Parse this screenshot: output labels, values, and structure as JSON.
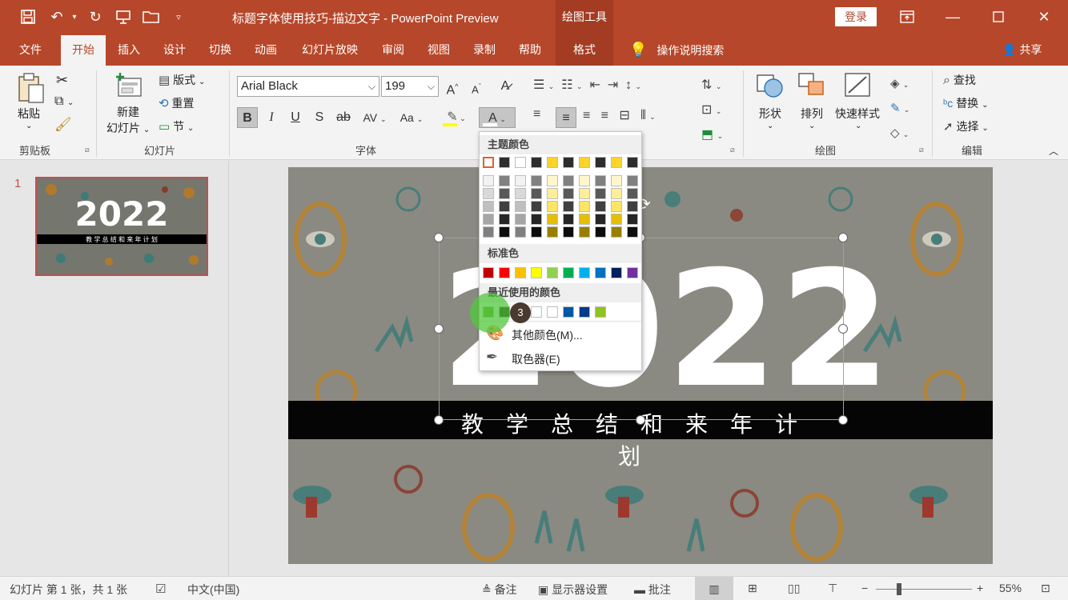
{
  "titlebar": {
    "doc_title": "标题字体使用技巧-描边文字  -  PowerPoint Preview",
    "contextual": "绘图工具",
    "login": "登录"
  },
  "tabs": [
    {
      "label": "文件"
    },
    {
      "label": "开始"
    },
    {
      "label": "插入"
    },
    {
      "label": "设计"
    },
    {
      "label": "切换"
    },
    {
      "label": "动画"
    },
    {
      "label": "幻灯片放映"
    },
    {
      "label": "审阅"
    },
    {
      "label": "视图"
    },
    {
      "label": "录制"
    },
    {
      "label": "帮助"
    },
    {
      "label": "格式"
    }
  ],
  "tell_me": "操作说明搜索",
  "share": "共享",
  "ribbon": {
    "clipboard": {
      "paste": "粘贴",
      "group": "剪贴板"
    },
    "slides": {
      "new_slide_1": "新建",
      "new_slide_2": "幻灯片",
      "layout": "版式",
      "reset": "重置",
      "section": "节",
      "group": "幻灯片"
    },
    "font": {
      "name": "Arial Black",
      "size": "199",
      "group": "字体"
    },
    "drawing": {
      "shape": "形状",
      "arrange": "排列",
      "quick_styles": "快速样式",
      "group": "绘图"
    },
    "editing": {
      "find": "查找",
      "replace": "替换",
      "select": "选择",
      "group": "编辑"
    }
  },
  "color_menu": {
    "theme_colors": "主题颜色",
    "standard_colors": "标准色",
    "recent_colors": "最近使用的颜色",
    "more_colors": "其他颜色(M)...",
    "eyedropper": "取色器(E)",
    "theme_top": [
      "#ffffff",
      "#2d2d2d",
      "#ffffff",
      "#2d2d2d",
      "#ffd42a",
      "#2d2d2d",
      "#ffd42a",
      "#2d2d2d",
      "#ffd42a",
      "#2d2d2d"
    ],
    "theme_shades": [
      [
        "#f2f2f2",
        "#d9d9d9",
        "#bfbfbf",
        "#a6a6a6",
        "#808080"
      ],
      [
        "#808080",
        "#595959",
        "#404040",
        "#262626",
        "#0d0d0d"
      ],
      [
        "#f2f2f2",
        "#d9d9d9",
        "#bfbfbf",
        "#a6a6a6",
        "#808080"
      ],
      [
        "#808080",
        "#595959",
        "#404040",
        "#262626",
        "#0d0d0d"
      ],
      [
        "#fff6cc",
        "#ffee99",
        "#ffe566",
        "#e6bf00",
        "#997f00"
      ],
      [
        "#808080",
        "#595959",
        "#404040",
        "#262626",
        "#0d0d0d"
      ],
      [
        "#fff6cc",
        "#ffee99",
        "#ffe566",
        "#e6bf00",
        "#997f00"
      ],
      [
        "#808080",
        "#595959",
        "#404040",
        "#262626",
        "#0d0d0d"
      ],
      [
        "#fff6cc",
        "#ffee99",
        "#ffe566",
        "#e6bf00",
        "#997f00"
      ],
      [
        "#808080",
        "#595959",
        "#404040",
        "#262626",
        "#0d0d0d"
      ]
    ],
    "standard": [
      "#c00000",
      "#ff0000",
      "#ffc000",
      "#ffff00",
      "#92d050",
      "#00b050",
      "#00b0f0",
      "#0070c0",
      "#002060",
      "#7030a0"
    ],
    "recent": [
      "#6aa52a",
      "#111111",
      "#ffffff",
      "#ffffff",
      "#ffffff",
      "#0058a8",
      "#003a8c",
      "#8fc31f"
    ]
  },
  "slide": {
    "year": "2022",
    "subtitle": "教学总结和来年计划",
    "thumb_year": "2022",
    "thumb_subtitle": "教 学 总 结 和 来 年 计 划",
    "number": "1"
  },
  "cursor_badge": "3",
  "status": {
    "slide_info": "幻灯片 第 1 张，共 1 张",
    "language": "中文(中国)",
    "notes": "备注",
    "display": "显示器设置",
    "comments": "批注",
    "zoom": "55%"
  }
}
